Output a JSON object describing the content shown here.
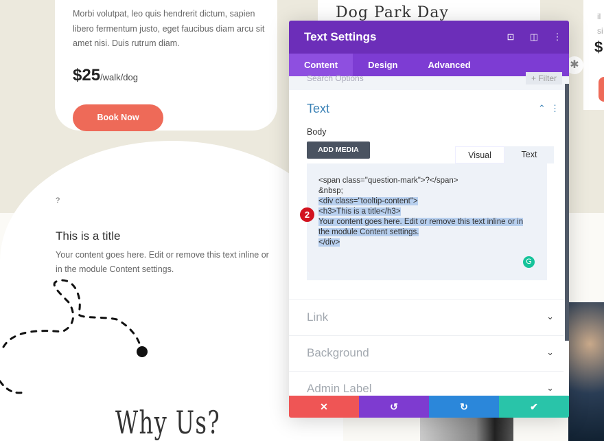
{
  "page": {
    "card1": {
      "description": "Morbi volutpat, leo quis hendrerit dictum, sapien libero fermentum justo, eget faucibus diam arcu sit amet nisi. Duis rutrum diam.",
      "price": "$25",
      "unit": "/walk/dog",
      "button": "Book Now"
    },
    "card2": {
      "heading": "Dog Park Day"
    },
    "card3": {
      "text": "il\nsi",
      "price": "$"
    },
    "question_mark": "?",
    "tooltip_title": "This is a title",
    "tooltip_body": "Your content goes here. Edit or remove this text inline or in the module Content settings.",
    "why_heading": "Why Us?"
  },
  "panel": {
    "title": "Text Settings",
    "icons": [
      "focus-icon",
      "split-view-icon",
      "more-icon"
    ],
    "tabs": [
      {
        "label": "Content",
        "active": true
      },
      {
        "label": "Design"
      },
      {
        "label": "Advanced"
      }
    ],
    "search_placeholder": "Search Options",
    "filter": "+ Filter",
    "section": "Text",
    "body_label": "Body",
    "add_media": "ADD MEDIA",
    "editor_tabs": [
      "Visual",
      "Text"
    ],
    "code_lines": [
      "<span class=\"question-mark\">?</span>",
      "",
      "&nbsp;"
    ],
    "selected_lines": [
      "<div class=\"tooltip-content\">",
      "<h3>This is a title</h3>",
      "Your content goes here. Edit or remove this text inline or in",
      "the module Content settings.",
      "</div>"
    ],
    "grammarly": "G",
    "badge": "2",
    "accordions": [
      "Link",
      "Background",
      "Admin Label"
    ],
    "footer": {
      "colors": {
        "cancel": "#ef5555",
        "undo": "#7e3bd0",
        "redo": "#2b87da",
        "save": "#29c4a9"
      }
    }
  },
  "colors": {
    "header": "#6c2eb9",
    "tabs": "#7d3cd3",
    "accent": "#ee6a58",
    "section": "#3b82b6"
  }
}
